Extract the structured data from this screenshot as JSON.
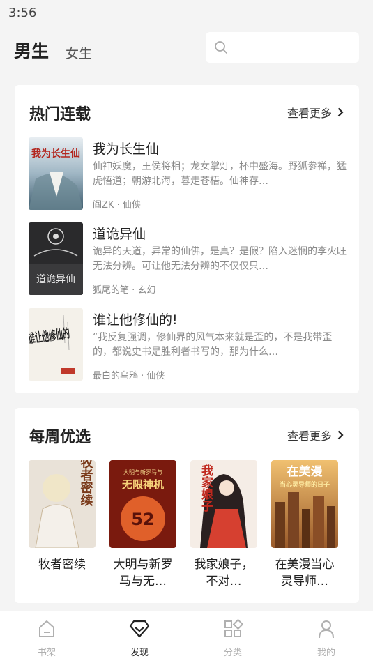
{
  "status": {
    "time": "3:56"
  },
  "header": {
    "tabs": [
      {
        "label": "男生",
        "active": true
      },
      {
        "label": "女生",
        "active": false
      }
    ],
    "search_placeholder": ""
  },
  "hot": {
    "title": "热门连载",
    "more": "查看更多",
    "books": [
      {
        "title": "我为长生仙",
        "desc": "仙神妖魔，王侯将相；龙女掌灯，杯中盛海。野狐参禅，猛虎悟道；朝游北海，暮走苍梧。仙神存…",
        "meta": "阎ZK · 仙侠",
        "cover_text": "我为长生仙"
      },
      {
        "title": "道诡异仙",
        "desc": "诡异的天道，异常的仙佛，是真？是假？陷入迷惘的李火旺无法分辨。可让他无法分辨的不仅仅只…",
        "meta": "狐尾的笔 · 玄幻",
        "cover_text": "道诡异仙"
      },
      {
        "title": "谁让他修仙的!",
        "desc": "“我反复强调，修仙界的风气本来就是歪的，不是我带歪的，都说史书是胜利者书写的，那为什么…",
        "meta": "最白的乌鸦 · 仙侠",
        "cover_text": "谁让他修仙的"
      }
    ]
  },
  "weekly": {
    "title": "每周优选",
    "more": "查看更多",
    "books": [
      {
        "title": "牧者密续",
        "cover_text": "牧者密续"
      },
      {
        "title": "大明与新罗马与无…",
        "cover_text": "无限神机",
        "cover_sub": "大明与新罗马与",
        "cover_num": "52"
      },
      {
        "title": "我家娘子，不对…",
        "cover_text": "我家娘子"
      },
      {
        "title": "在美漫当心灵导师…",
        "cover_text": "在美漫",
        "cover_sub": "当心灵导师的日子"
      }
    ]
  },
  "nav": [
    {
      "label": "书架",
      "icon": "home-icon",
      "active": false
    },
    {
      "label": "发现",
      "icon": "discover-icon",
      "active": true
    },
    {
      "label": "分类",
      "icon": "category-icon",
      "active": false
    },
    {
      "label": "我的",
      "icon": "profile-icon",
      "active": false
    }
  ],
  "colors": {
    "background": "#f4f4f4",
    "card": "#ffffff",
    "muted": "#8a8a8a",
    "nav_inactive": "#b0b0b0"
  }
}
